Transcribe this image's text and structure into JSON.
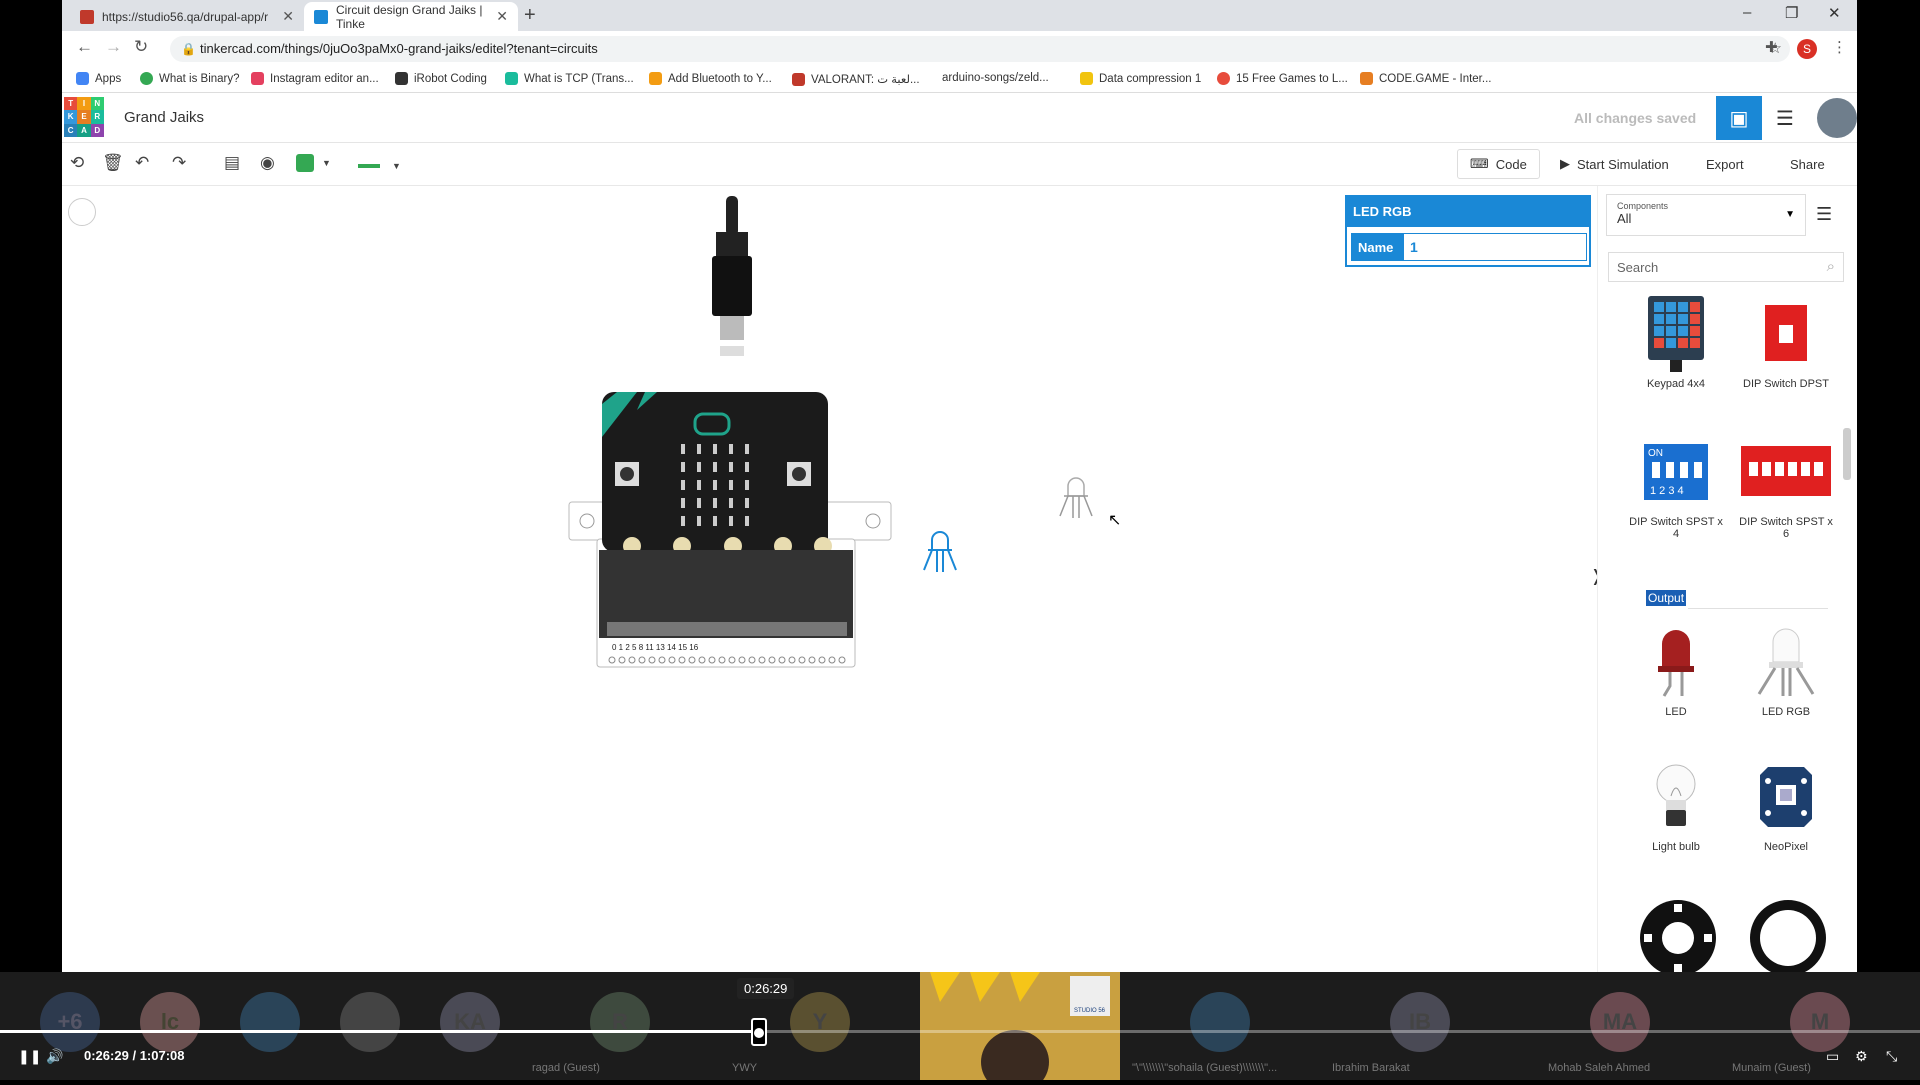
{
  "browser": {
    "tabs": [
      {
        "title": "https://studio56.qa/drupal-app/r",
        "close": "✕"
      },
      {
        "title": "Circuit design Grand Jaiks | Tinke",
        "close": "✕"
      }
    ],
    "new_tab": "+",
    "url": "tinkercad.com/things/0juOo3paMx0-grand-jaiks/editel?tenant=circuits",
    "profile_initial": "S",
    "window_controls": [
      "–",
      "❐",
      "✕"
    ],
    "bookmarks": [
      "Apps",
      "What is Binary?",
      "Instagram editor an...",
      "iRobot Coding",
      "What is TCP (Trans...",
      "Add Bluetooth to Y...",
      "VALORANT: لعبة ت...",
      "arduino-songs/zeld...",
      "Data compression 1",
      "15 Free Games to L...",
      "CODE.GAME - Inter..."
    ]
  },
  "header": {
    "logo_letters": [
      "T",
      "I",
      "N",
      "K",
      "E",
      "R",
      "C",
      "A",
      "D"
    ],
    "title": "Grand Jaiks",
    "save_status": "All changes saved"
  },
  "toolbar": {
    "code_label": "Code",
    "simulate_label": "Start Simulation",
    "export_label": "Export",
    "share_label": "Share",
    "fill_color": "#34a853",
    "wire_color": "#34a853"
  },
  "inspector": {
    "component": "LED RGB",
    "name_label": "Name",
    "name_value": "1"
  },
  "sidebar": {
    "components_label": "Components",
    "components_value": "All",
    "search_placeholder": "Search",
    "section": "Output",
    "items": [
      {
        "label": "Keypad 4x4"
      },
      {
        "label": "DIP Switch DPST"
      },
      {
        "label": "DIP Switch SPST x 4"
      },
      {
        "label": "DIP Switch SPST x 6"
      },
      {
        "label": "LED"
      },
      {
        "label": "LED RGB"
      },
      {
        "label": "Light bulb"
      },
      {
        "label": "NeoPixel"
      }
    ]
  },
  "microbit": {
    "pin_labels": "0  1  2   5     8     11  13 14 15 16"
  },
  "video": {
    "tooltip_time": "0:26:29",
    "current_time": "0:26:29",
    "separator": "/",
    "duration": "1:07:08",
    "progress": 0.395,
    "participants": [
      {
        "initial": "+6",
        "name": ""
      },
      {
        "initial": "lc",
        "name": ""
      },
      {
        "initial": "",
        "name": ""
      },
      {
        "initial": "",
        "name": ""
      },
      {
        "initial": "KA",
        "name": ""
      },
      {
        "initial": "R",
        "name": "ragad (Guest)"
      },
      {
        "initial": "Y",
        "name": "YWY"
      },
      {
        "initial": "",
        "name": "\"\\\"\\\\\\\\\\\\\\\"sohaila  (Guest)\\\\\\\\\\\\\\\"..."
      },
      {
        "initial": "IB",
        "name": "Ibrahim Barakat"
      },
      {
        "initial": "MA",
        "name": "Mohab   Saleh Ahmed"
      },
      {
        "initial": "M",
        "name": "Munaim (Guest)"
      }
    ],
    "studio_badge": "STUDIO 56"
  }
}
